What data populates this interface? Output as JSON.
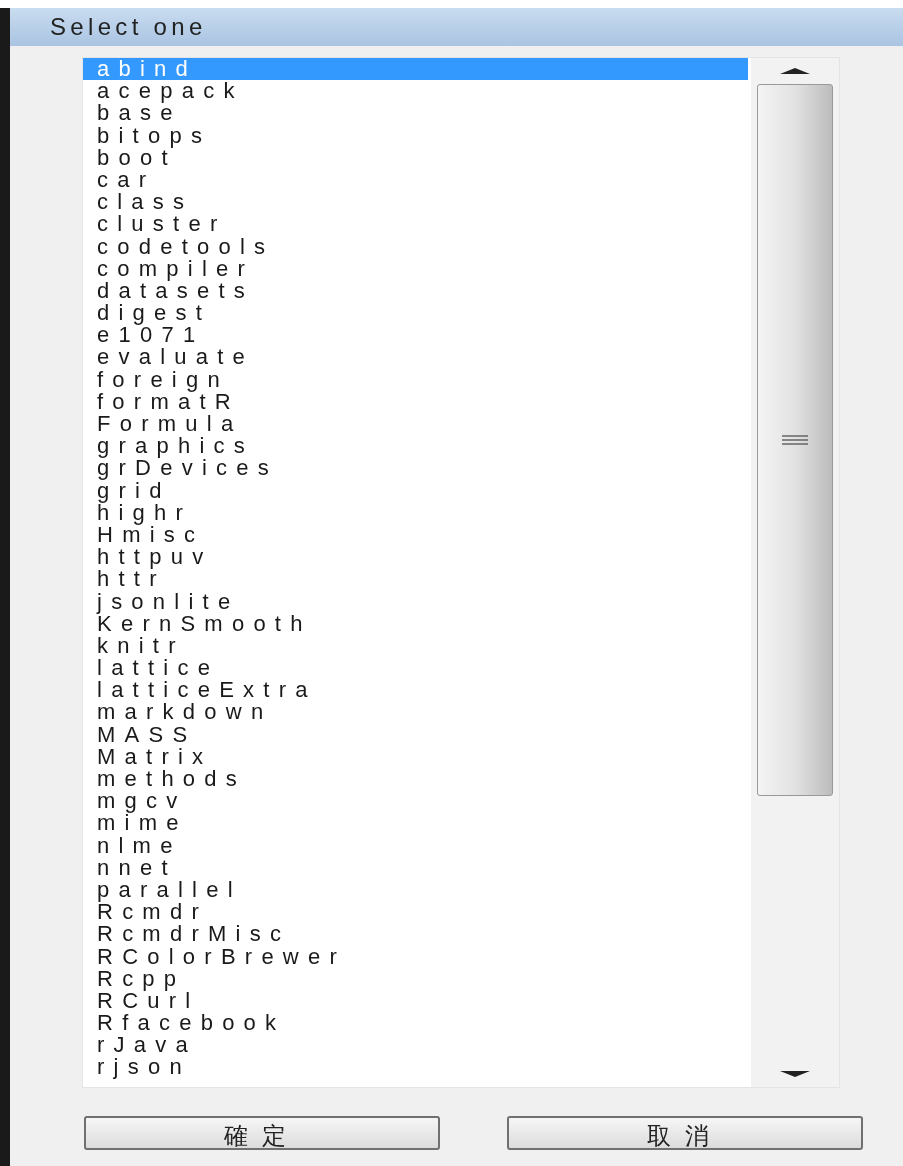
{
  "window": {
    "title": "Select one"
  },
  "list": {
    "items": [
      {
        "label": "abind",
        "selected": true
      },
      {
        "label": "acepack",
        "selected": false
      },
      {
        "label": "base",
        "selected": false
      },
      {
        "label": "bitops",
        "selected": false
      },
      {
        "label": "boot",
        "selected": false
      },
      {
        "label": "car",
        "selected": false
      },
      {
        "label": "class",
        "selected": false
      },
      {
        "label": "cluster",
        "selected": false
      },
      {
        "label": "codetools",
        "selected": false
      },
      {
        "label": "compiler",
        "selected": false
      },
      {
        "label": "datasets",
        "selected": false
      },
      {
        "label": "digest",
        "selected": false
      },
      {
        "label": "e1071",
        "selected": false
      },
      {
        "label": "evaluate",
        "selected": false
      },
      {
        "label": "foreign",
        "selected": false
      },
      {
        "label": "formatR",
        "selected": false
      },
      {
        "label": "Formula",
        "selected": false
      },
      {
        "label": "graphics",
        "selected": false
      },
      {
        "label": "grDevices",
        "selected": false
      },
      {
        "label": "grid",
        "selected": false
      },
      {
        "label": "highr",
        "selected": false
      },
      {
        "label": "Hmisc",
        "selected": false
      },
      {
        "label": "httpuv",
        "selected": false
      },
      {
        "label": "httr",
        "selected": false
      },
      {
        "label": "jsonlite",
        "selected": false
      },
      {
        "label": "KernSmooth",
        "selected": false
      },
      {
        "label": "knitr",
        "selected": false
      },
      {
        "label": "lattice",
        "selected": false
      },
      {
        "label": "latticeExtra",
        "selected": false
      },
      {
        "label": "markdown",
        "selected": false
      },
      {
        "label": "MASS",
        "selected": false
      },
      {
        "label": "Matrix",
        "selected": false
      },
      {
        "label": "methods",
        "selected": false
      },
      {
        "label": "mgcv",
        "selected": false
      },
      {
        "label": "mime",
        "selected": false
      },
      {
        "label": "nlme",
        "selected": false
      },
      {
        "label": "nnet",
        "selected": false
      },
      {
        "label": "parallel",
        "selected": false
      },
      {
        "label": "Rcmdr",
        "selected": false
      },
      {
        "label": "RcmdrMisc",
        "selected": false
      },
      {
        "label": "RColorBrewer",
        "selected": false
      },
      {
        "label": "Rcpp",
        "selected": false
      },
      {
        "label": "RCurl",
        "selected": false
      },
      {
        "label": "Rfacebook",
        "selected": false
      },
      {
        "label": "rJava",
        "selected": false
      },
      {
        "label": "rjson",
        "selected": false
      }
    ]
  },
  "buttons": [
    "確定",
    "取消"
  ]
}
